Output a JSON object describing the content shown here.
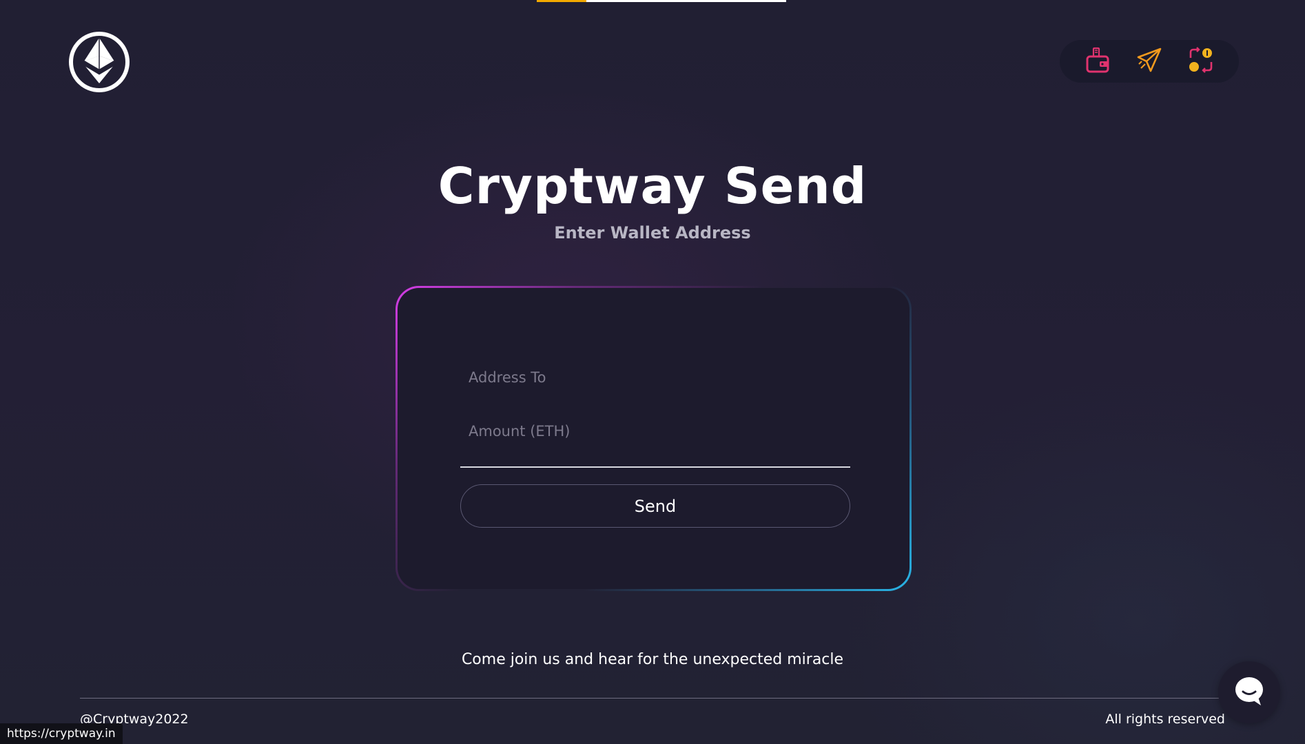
{
  "page_progress": {
    "fill_fraction": 0.2,
    "colors": {
      "fill": "#f2a900",
      "track": "#ffffff"
    }
  },
  "logo": {
    "icon": "ethereum-icon"
  },
  "nav": {
    "items": [
      {
        "icon": "wallet-icon",
        "color": "#e0336e"
      },
      {
        "icon": "send-plane-icon",
        "color": "#f29a1e"
      },
      {
        "icon": "swap-coins-icon",
        "colors": [
          "#f2b21e",
          "#e0336e"
        ]
      }
    ]
  },
  "hero": {
    "title": "Cryptway Send",
    "subtitle": "Enter Wallet Address"
  },
  "form": {
    "address_placeholder": "Address To",
    "address_value": "",
    "amount_placeholder": "Amount (ETH)",
    "amount_value": "",
    "send_label": "Send",
    "border_gradient": [
      "#d63ee8",
      "#29b6e8"
    ]
  },
  "tagline": "Come join us and hear for the unexpected miracle",
  "footer": {
    "left": "@Cryptway2022",
    "right": "All rights reserved"
  },
  "chat": {
    "icon": "chat-bubble-icon"
  },
  "status_bar": {
    "url": "https://cryptway.in"
  }
}
